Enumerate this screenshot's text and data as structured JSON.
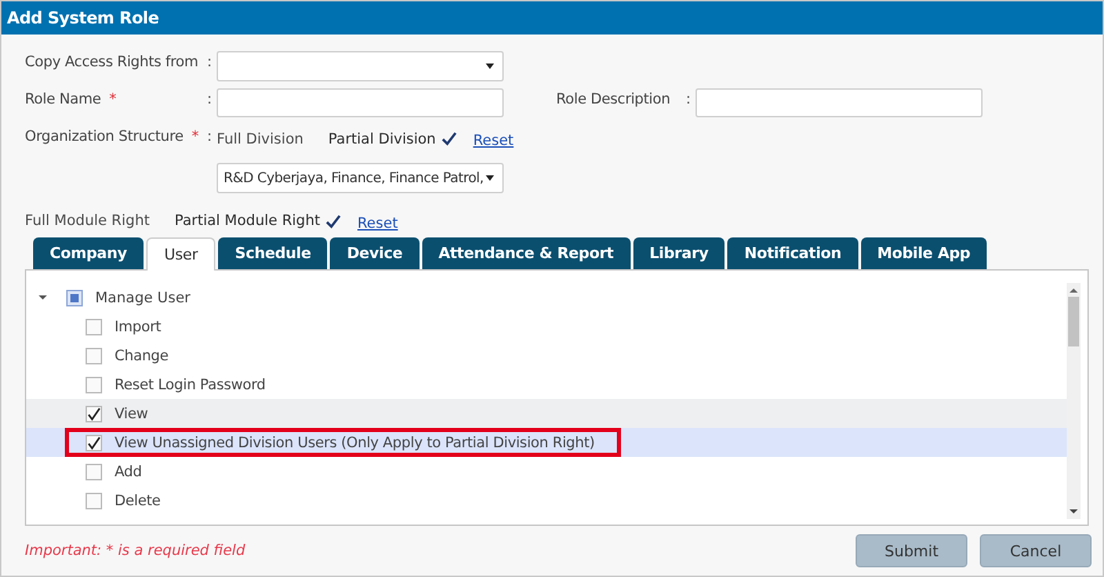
{
  "window": {
    "title": "Add System Role"
  },
  "form": {
    "copy_from": {
      "label": "Copy Access Rights from",
      "separator": ":"
    },
    "role_name": {
      "label": "Role Name",
      "required_mark": "*",
      "separator": ":"
    },
    "role_description": {
      "label": "Role Description",
      "separator": ":"
    },
    "organization": {
      "label": "Organization Structure",
      "required_mark": "*",
      "separator": ":",
      "options": [
        {
          "label": "Full Division",
          "selected": false
        },
        {
          "label": "Partial Division",
          "selected": true
        }
      ],
      "reset": "Reset",
      "divisions": "R&D Cyberjaya, Finance, Finance Patrol,"
    },
    "module_right": {
      "options": [
        {
          "label": "Full Module Right",
          "selected": false
        },
        {
          "label": "Partial Module Right",
          "selected": true
        }
      ],
      "reset": "Reset"
    }
  },
  "tabs": [
    {
      "label": "Company",
      "selected": false
    },
    {
      "label": "User",
      "selected": true
    },
    {
      "label": "Schedule",
      "selected": false
    },
    {
      "label": "Device",
      "selected": false
    },
    {
      "label": "Attendance & Report",
      "selected": false
    },
    {
      "label": "Library",
      "selected": false
    },
    {
      "label": "Notification",
      "selected": false
    },
    {
      "label": "Mobile App",
      "selected": false
    }
  ],
  "tree": {
    "label": "Manage User",
    "expanded": true,
    "partial": true,
    "children": [
      {
        "label": "Import",
        "checked": false,
        "selected": false,
        "hovered": false,
        "outlined": false
      },
      {
        "label": "Change",
        "checked": false,
        "selected": false,
        "hovered": false,
        "outlined": false
      },
      {
        "label": "Reset Login Password",
        "checked": false,
        "selected": false,
        "hovered": false,
        "outlined": false
      },
      {
        "label": "View",
        "checked": true,
        "selected": false,
        "hovered": true,
        "outlined": false
      },
      {
        "label": "View Unassigned Division Users (Only Apply to Partial Division Right)",
        "checked": true,
        "selected": true,
        "hovered": false,
        "outlined": true
      },
      {
        "label": "Add",
        "checked": false,
        "selected": false,
        "hovered": false,
        "outlined": false
      },
      {
        "label": "Delete",
        "checked": false,
        "selected": false,
        "hovered": false,
        "outlined": false
      }
    ]
  },
  "footer": {
    "note": "Important: * is a required field",
    "buttons": [
      "Submit",
      "Cancel"
    ]
  }
}
